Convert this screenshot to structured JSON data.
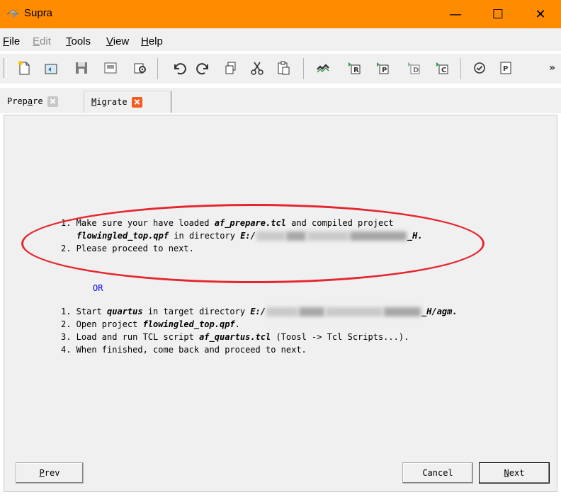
{
  "window": {
    "title": "Supra",
    "minimize_glyph": "—",
    "maximize_glyph": "☐",
    "close_glyph": "✕",
    "titlebar_color": "#ff8c00"
  },
  "menu": {
    "items": [
      {
        "key": "F",
        "rest": "ile",
        "enabled": true
      },
      {
        "key": "E",
        "rest": "dit",
        "enabled": false
      },
      {
        "key": "T",
        "rest": "ools",
        "enabled": true
      },
      {
        "key": "V",
        "rest": "iew",
        "enabled": true
      },
      {
        "key": "H",
        "rest": "elp",
        "enabled": true
      }
    ]
  },
  "toolbar": {
    "icons": [
      "new-project-icon",
      "open-icon",
      "save-icon",
      "save-as-icon",
      "settings-icon",
      "undo-icon",
      "redo-icon",
      "copy-icon",
      "cut-icon",
      "paste-icon",
      "migrate-icon",
      "run-r-icon",
      "run-p-icon",
      "run-d-icon",
      "run-c-icon",
      "check-icon",
      "properties-icon"
    ],
    "overflow_glyph": "»"
  },
  "tabs": [
    {
      "prefix": "Prep",
      "key": "a",
      "suffix": "re",
      "close_color": "#c8c8c8"
    },
    {
      "prefix": "",
      "key": "M",
      "suffix": "igrate",
      "close_color": "#f25c1f"
    }
  ],
  "instructions": {
    "p1": {
      "line1_prefix": "1. Make sure your have loaded ",
      "line1_bold": "af_prepare.tcl",
      "line1_suffix": " and compiled project",
      "line2_bold": "flowingled_top.qpf",
      "line2_mid": " in directory ",
      "line2_path": "E:/",
      "line2_end": "_H.",
      "line3": "2. Please proceed to next."
    },
    "or": "OR",
    "p2": {
      "l1_prefix": "1. Start ",
      "l1_bold": "quartus",
      "l1_mid": " in target directory ",
      "l1_path": "E:/",
      "l1_end": "_H/agm.",
      "l2_prefix": "2. Open project ",
      "l2_bold": "flowingled_top.qpf",
      "l2_end": ".",
      "l3_prefix": "3. Load and run TCL script ",
      "l3_bold": "af_quartus.tcl",
      "l3_end": " (Toosl -> Tcl Scripts...).",
      "l4": "4. When finished, come back and proceed to next."
    },
    "annotation_color": "#e5262d"
  },
  "buttons": {
    "prev_key": "P",
    "prev_rest": "rev",
    "cancel": "Cancel",
    "next_key": "N",
    "next_rest": "ext"
  }
}
